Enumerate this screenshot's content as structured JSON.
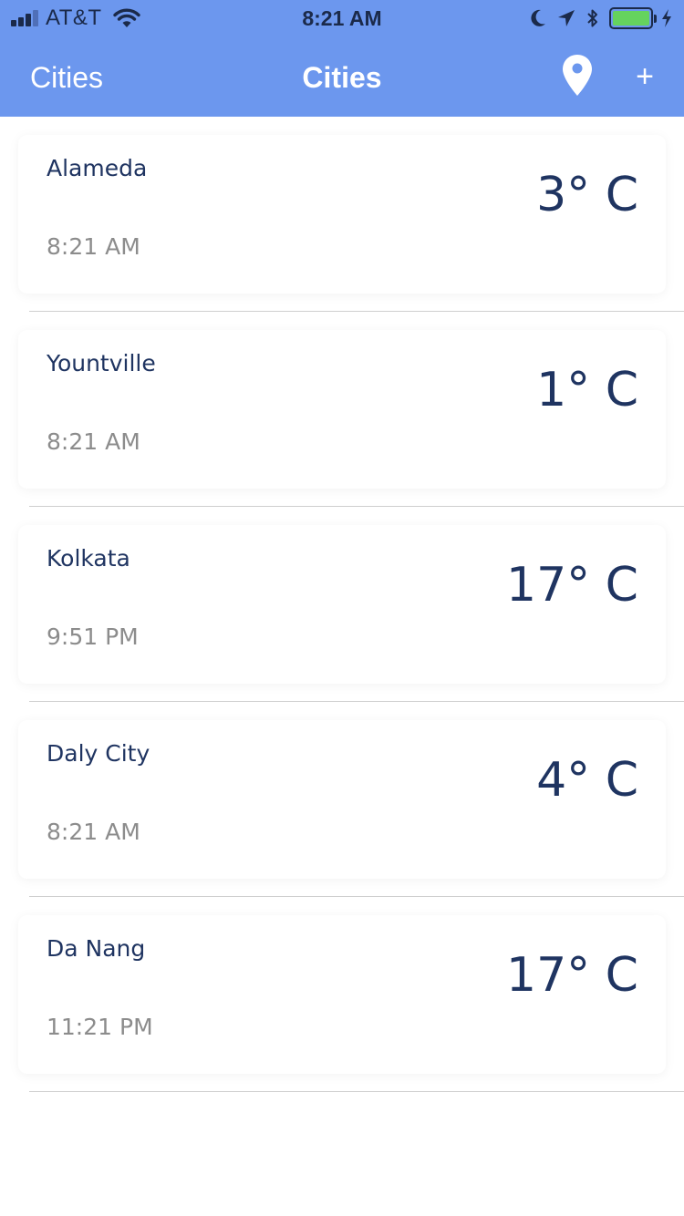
{
  "status_bar": {
    "carrier": "AT&T",
    "time": "8:21 AM",
    "battery_level": 1.0
  },
  "nav": {
    "back_label": "Cities",
    "title": "Cities",
    "add_label": "+"
  },
  "cities": [
    {
      "name": "Alameda",
      "time": "8:21 AM",
      "temperature": "3° C"
    },
    {
      "name": "Yountville",
      "time": "8:21 AM",
      "temperature": "1° C"
    },
    {
      "name": "Kolkata",
      "time": "9:51 PM",
      "temperature": "17° C"
    },
    {
      "name": "Daly City",
      "time": "8:21 AM",
      "temperature": "4° C"
    },
    {
      "name": "Da Nang",
      "time": "11:21 PM",
      "temperature": "17° C"
    }
  ],
  "colors": {
    "header_bg": "#6c97ee",
    "text_primary": "#1f3461",
    "text_secondary": "#8c8c8c",
    "battery": "#65d35e"
  }
}
